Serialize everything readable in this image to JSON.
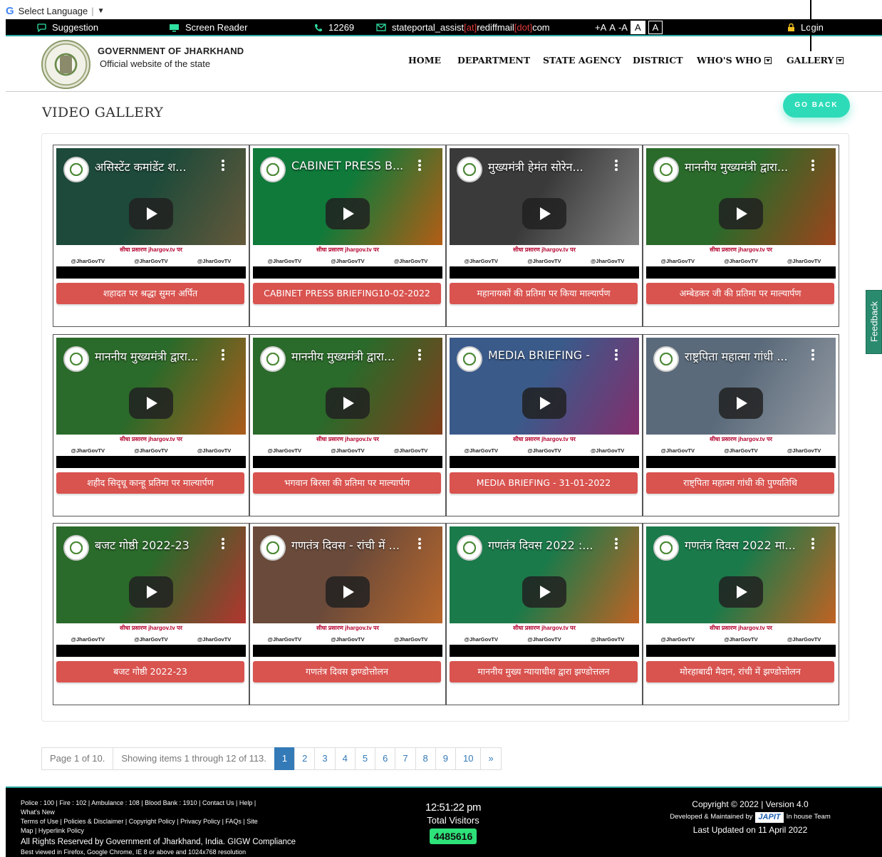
{
  "translate": {
    "label": "Select Language"
  },
  "topbar": {
    "suggestion": "Suggestion",
    "screen_reader": "Screen Reader",
    "phone": "12269",
    "email_parts": [
      "stateportal_assist",
      "[at]",
      "rediffmail",
      "[dot]",
      "com"
    ],
    "font_controls": [
      "+A",
      "A",
      "-A"
    ],
    "contrast": [
      "A",
      "A"
    ],
    "login": "Login"
  },
  "header": {
    "org_title": "GOVERNMENT OF JHARKHAND",
    "org_subtitle": "Official website of the state",
    "nav": [
      "HOME",
      "DEPARTMENT",
      "STATE AGENCY",
      "DISTRICT",
      "WHO'S WHO",
      "GALLERY"
    ]
  },
  "page": {
    "title": "VIDEO GALLERY",
    "go_back": "GO BACK"
  },
  "videos": [
    {
      "thumb_title": "असिस्टेंट कमांडेंट श...",
      "label": "शहादत पर श्रद्धा सुमन अर्पित",
      "bg": [
        "#1d4a3a",
        "#6b5a3a"
      ]
    },
    {
      "thumb_title": "CABINET PRESS B...",
      "label": "CABINET PRESS BRIEFING10-02-2022",
      "bg": [
        "#0f7a3a",
        "#c25a12"
      ]
    },
    {
      "thumb_title": "मुख्यमंत्री हेमंत सोरेन...",
      "label": "महानायकों की प्रतिमा पर किया माल्यार्पण",
      "bg": [
        "#3a3a3a",
        "#8a8a8a"
      ]
    },
    {
      "thumb_title": "माननीय मुख्यमंत्री द्वारा...",
      "label": "अम्बेडकर जी की प्रतिमा पर माल्यार्पण",
      "bg": [
        "#2a6a2a",
        "#a8401a"
      ]
    },
    {
      "thumb_title": "माननीय मुख्यमंत्री द्वारा...",
      "label": "शहीद सिदृधू कान्हू प्रतिमा पर माल्यार्पण",
      "bg": [
        "#2a6a2a",
        "#b85a1a"
      ]
    },
    {
      "thumb_title": "माननीय मुख्यमंत्री द्वारा...",
      "label": "भगवान बिरसा की प्रतिमा पर माल्यार्पण",
      "bg": [
        "#2a6a2a",
        "#8a3a1a"
      ]
    },
    {
      "thumb_title": "MEDIA BRIEFING -",
      "label": "MEDIA BRIEFING - 31-01-2022",
      "bg": [
        "#3a5a8a",
        "#8a2a6a"
      ]
    },
    {
      "thumb_title": "राष्ट्रपिता महात्मा गांधी ...",
      "label": "राष्ट्पिता महात्मा गांधी की पुण्यतिथि",
      "bg": [
        "#5a6a7a",
        "#9aa0a8"
      ]
    },
    {
      "thumb_title": "बजट गोष्ठी 2022-23",
      "label": "बजट गोष्ठी 2022-23",
      "bg": [
        "#2a6a2a",
        "#c03030"
      ]
    },
    {
      "thumb_title": "गणतंत्र दिवस - रांची में ...",
      "label": "गणतंत्र दिवस झण्डोत्तोलन",
      "bg": [
        "#6a4a3a",
        "#c06a2a"
      ]
    },
    {
      "thumb_title": "गणतंत्र दिवस 2022 :...",
      "label": "माननीय मुख्य न्यायाधीश द्वारा झण्डोत्तलन",
      "bg": [
        "#1a7a4a",
        "#d06020"
      ]
    },
    {
      "thumb_title": "गणतंत्र दिवस 2022 मा...",
      "label": "मोरहाबादी मैदान, रांची में झण्डोत्तोलन",
      "bg": [
        "#1a7a4a",
        "#d06020"
      ]
    }
  ],
  "social": {
    "handles": [
      "@JharGovTV",
      "@JharGovTV",
      "@JharGovTV"
    ],
    "promo": "सीधा प्रसारण jhargov.tv पर"
  },
  "pagination": {
    "info": "Page 1 of 10.",
    "showing": "Showing items 1 through 12 of 113.",
    "pages": [
      "1",
      "2",
      "3",
      "4",
      "5",
      "6",
      "7",
      "8",
      "9",
      "10",
      "»"
    ],
    "active": "1"
  },
  "footer": {
    "emergency": "Police : 100 | Fire : 102 | Ambulance : 108 | Blood Bank : 1910 | Contact Us | Help |",
    "links1": "What's New",
    "links2": "Terms of Use | Policies & Disclaimer | Copyright Policy | Privacy Policy | FAQs | Site",
    "links3": "Map | Hyperlink Policy",
    "rights": "All Rights Reserved by Government of Jharkhand, India. GIGW Compliance",
    "best_viewed": "Best viewed in Firefox, Google Chrome, IE 8 or above and 1024x768 resolution",
    "clock": "12:51:22 pm",
    "visitors_label": "Total Visitors",
    "visitors_count": "4485616",
    "copyright": "Copyright © 2022 | Version 4.0",
    "developed_by": "Developed & Maintained by",
    "dev_brand": "JAPIT",
    "dev_team": "In house Team",
    "last_updated": "Last Updated on 11 April 2022"
  },
  "feedback": "Feedback",
  "colors": {
    "accent": "#2fa9a3",
    "label_red": "#d9534f",
    "pager_blue": "#337ab7",
    "go_back": "#2edbb9"
  }
}
